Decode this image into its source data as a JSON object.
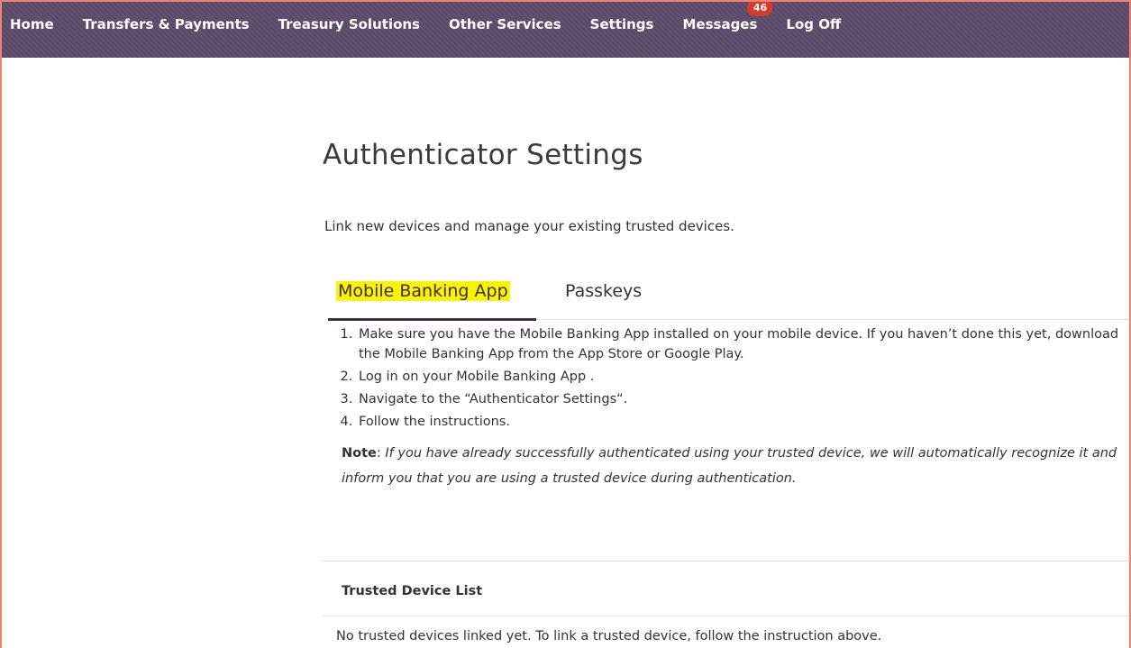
{
  "nav": {
    "items": [
      {
        "label": "Home"
      },
      {
        "label": "Transfers & Payments"
      },
      {
        "label": "Treasury Solutions"
      },
      {
        "label": "Other Services"
      },
      {
        "label": "Settings"
      },
      {
        "label": "Messages",
        "badge": "46"
      },
      {
        "label": "Log Off"
      }
    ]
  },
  "page": {
    "title": "Authenticator Settings",
    "subtitle": "Link new devices and manage your existing trusted devices."
  },
  "tabs": [
    {
      "label": "Mobile Banking App",
      "active": true,
      "highlight_color": "#fff200"
    },
    {
      "label": "Passkeys",
      "active": false
    }
  ],
  "instructions": {
    "steps": [
      "Make sure you have the Mobile Banking App installed on your mobile device. If you haven’t done this yet, download the Mobile Banking App from the App Store or Google Play.",
      "Log in on your Mobile Banking App .",
      "Navigate to the “Authenticator Settings“.",
      "Follow the instructions."
    ],
    "note_label": "Note",
    "note_text": "If you have already successfully authenticated using your trusted device, we will automatically recognize it and inform you that you are using a trusted device during authentication."
  },
  "trusted_devices": {
    "header": "Trusted Device List",
    "empty_message": "No trusted devices linked yet. To link a trusted device, follow the instruction above."
  },
  "colors": {
    "nav_background": "#5e4b6b",
    "badge": "#d9392b",
    "tab_underline": "#3e2f48",
    "frame_border": "#f0836b"
  }
}
